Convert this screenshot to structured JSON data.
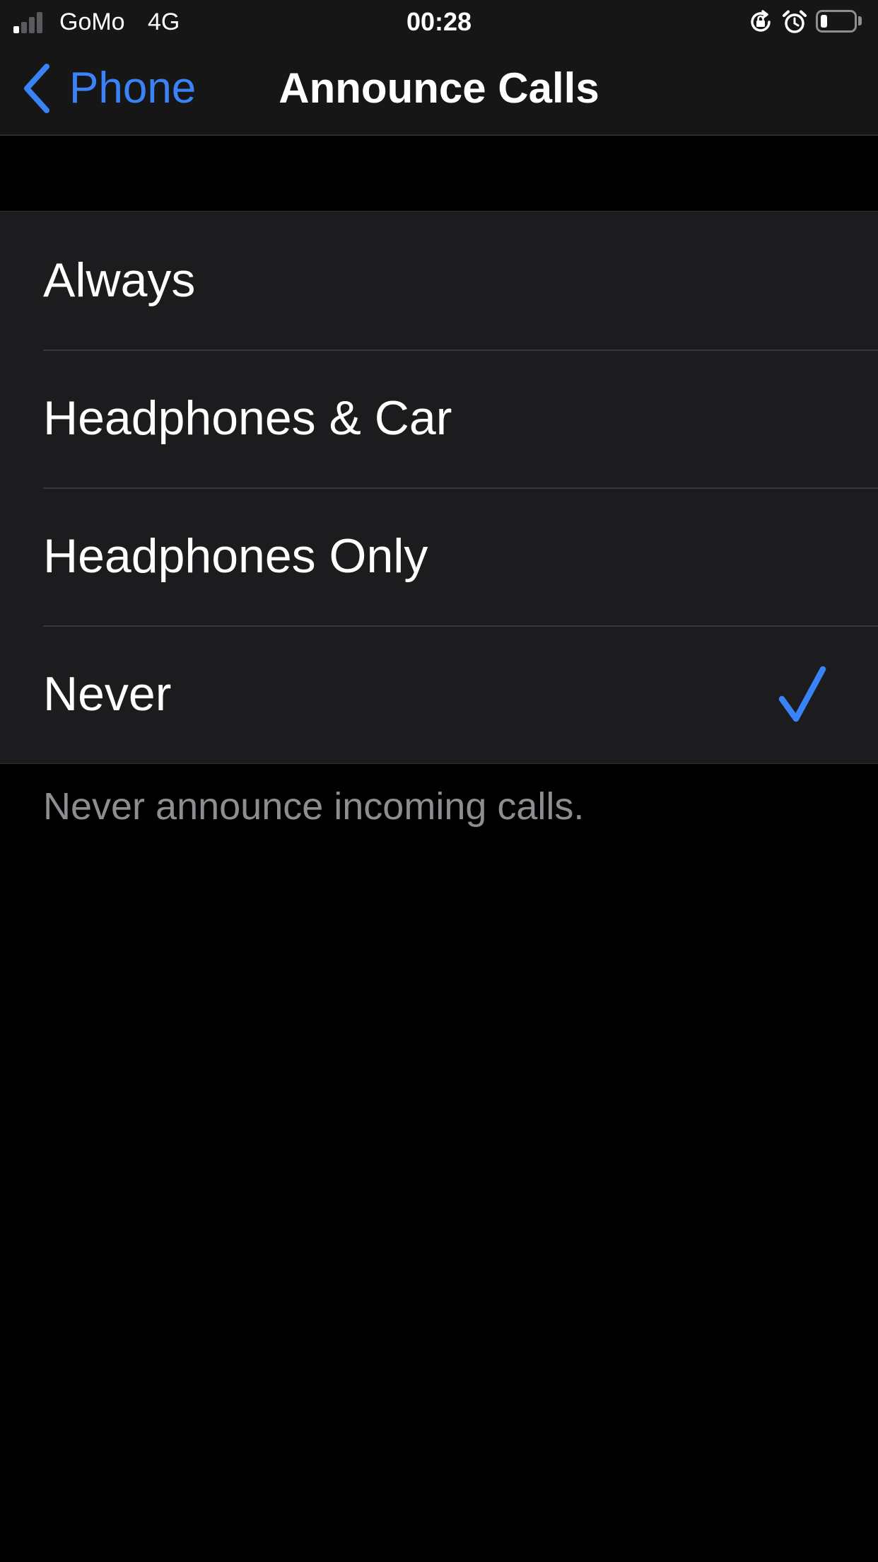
{
  "status_bar": {
    "carrier": "GoMo",
    "network": "4G",
    "time": "00:28",
    "signal_bars_active": 1,
    "signal_bars_total": 4,
    "battery_level": 0.2,
    "icons": [
      "signal-icon",
      "orientation-lock-icon",
      "alarm-icon",
      "battery-icon"
    ]
  },
  "nav": {
    "back_label": "Phone",
    "title": "Announce Calls"
  },
  "options": [
    {
      "label": "Always",
      "selected": false
    },
    {
      "label": "Headphones & Car",
      "selected": false
    },
    {
      "label": "Headphones Only",
      "selected": false
    },
    {
      "label": "Never",
      "selected": true
    }
  ],
  "footer_note": "Never announce incoming calls.",
  "colors": {
    "accent": "#3a82f7",
    "background": "#000000",
    "cell_background": "#1c1c1e",
    "bar_background": "#161616",
    "secondary_text": "#8d8d92"
  }
}
